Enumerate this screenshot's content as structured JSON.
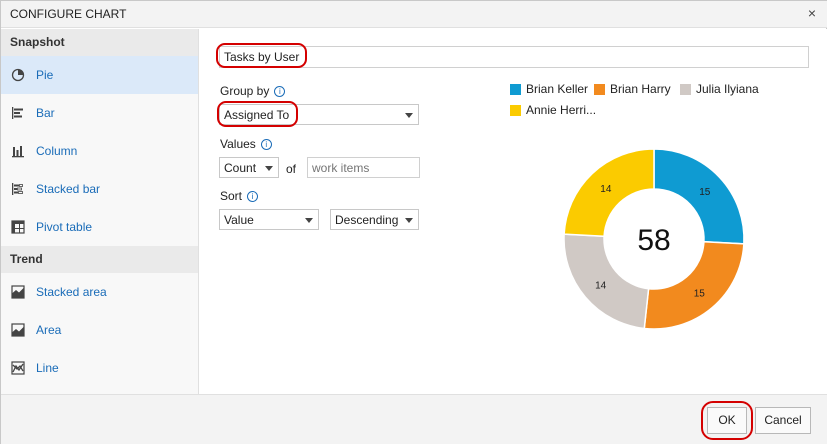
{
  "dialog": {
    "title": "CONFIGURE CHART",
    "close_glyph": "×"
  },
  "sidebar": {
    "sections": [
      {
        "title": "Snapshot",
        "items": [
          {
            "label": "Pie",
            "icon": "pie-chart-icon",
            "selected": true
          },
          {
            "label": "Bar",
            "icon": "bar-chart-icon",
            "selected": false
          },
          {
            "label": "Column",
            "icon": "column-chart-icon",
            "selected": false
          },
          {
            "label": "Stacked bar",
            "icon": "stacked-bar-icon",
            "selected": false
          },
          {
            "label": "Pivot table",
            "icon": "pivot-table-icon",
            "selected": false
          }
        ]
      },
      {
        "title": "Trend",
        "items": [
          {
            "label": "Stacked area",
            "icon": "stacked-area-icon",
            "selected": false
          },
          {
            "label": "Area",
            "icon": "area-chart-icon",
            "selected": false
          },
          {
            "label": "Line",
            "icon": "line-chart-icon",
            "selected": false
          }
        ]
      }
    ]
  },
  "form": {
    "chart_title_value": "Tasks by User",
    "group_by": {
      "label": "Group by",
      "value": "Assigned To"
    },
    "values": {
      "label": "Values",
      "aggregate": "Count",
      "of_text": "of",
      "field_placeholder": "work items"
    },
    "sort": {
      "label": "Sort",
      "by": "Value",
      "direction": "Descending"
    },
    "info_glyph": "i"
  },
  "chart_data": {
    "type": "pie",
    "style": "donut",
    "total_label": "58",
    "slices": [
      {
        "name": "Brian Keller",
        "value": 15,
        "color": "#0f9bd2"
      },
      {
        "name": "Brian Harry",
        "value": 15,
        "color": "#f28a1e"
      },
      {
        "name": "Julia Ilyiana",
        "value": 14,
        "color": "#d0c9c5"
      },
      {
        "name": "Annie Herri...",
        "value": 14,
        "color": "#fbcb00"
      }
    ]
  },
  "footer": {
    "ok_label": "OK",
    "cancel_label": "Cancel"
  },
  "highlights": {
    "color": "#d40000"
  }
}
